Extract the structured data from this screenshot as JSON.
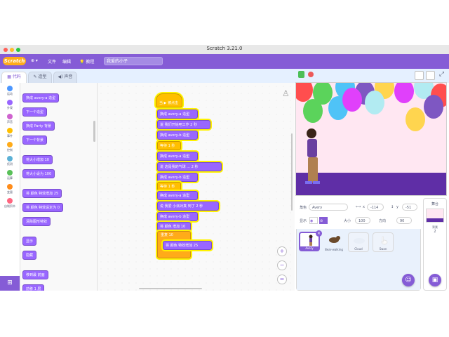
{
  "window": {
    "title": "Scratch 3.21.0"
  },
  "menubar": {
    "logo": "Scratch",
    "items": [
      {
        "label": "⊕ ▾"
      },
      {
        "label": "文件"
      },
      {
        "label": "编辑"
      },
      {
        "label": "教程"
      }
    ],
    "project_title": "我爱的小子"
  },
  "tabs": [
    {
      "label": "代码",
      "active": true
    },
    {
      "label": "造型",
      "active": false
    },
    {
      "label": "声音",
      "active": false
    }
  ],
  "categories": [
    {
      "label": "运动",
      "color": "#4c97ff"
    },
    {
      "label": "外观",
      "color": "#9966ff"
    },
    {
      "label": "声音",
      "color": "#cf63cf"
    },
    {
      "label": "事件",
      "color": "#ffbf00"
    },
    {
      "label": "控制",
      "color": "#ffab19"
    },
    {
      "label": "侦测",
      "color": "#5cb1d6"
    },
    {
      "label": "运算",
      "color": "#59c059"
    },
    {
      "label": "变量",
      "color": "#ff8c1a"
    },
    {
      "label": "自制积木",
      "color": "#ff6680"
    }
  ],
  "palette": {
    "blocks": [
      {
        "text": "换成 avery-a 造型"
      },
      {
        "text": "下一个造型"
      },
      {
        "text": "换成 Party 背景"
      },
      {
        "text": "下一个背景"
      },
      {
        "text": "将大小增加 10"
      },
      {
        "text": "将大小设为 100"
      },
      {
        "text": "将 颜色 特效增加 25"
      },
      {
        "text": "将 颜色 特效设定为 0"
      },
      {
        "text": "清除图形特效"
      },
      {
        "text": "显示"
      },
      {
        "text": "隐藏"
      },
      {
        "text": "移到最 前面"
      },
      {
        "text": "前移 1 层"
      }
    ]
  },
  "script": {
    "blocks": [
      {
        "text": "当 ▶ 被点击",
        "style": "hat"
      },
      {
        "text": "换成 avery-a 造型"
      },
      {
        "text": "说 我们开始吧工作 2 秒"
      },
      {
        "text": "换成 avery-b 造型"
      },
      {
        "text": "等待 1 秒"
      },
      {
        "text": "换成 avery-a 造型"
      },
      {
        "text": "说 这是我的气球 … 2 秒"
      },
      {
        "text": "换成 avery-b 造型"
      },
      {
        "text": "等待 1 秒"
      },
      {
        "text": "换成 avery-a 造型"
      },
      {
        "text": "说 我爱 小派对真 到了 2 秒"
      },
      {
        "text": "换成 avery-b 造型"
      },
      {
        "text": "将 颜色 增加 10"
      },
      {
        "text": "重复 10"
      },
      {
        "text": "将 颜色 特效增加 25"
      }
    ]
  },
  "zoom": {
    "in": "+",
    "out": "−",
    "reset": "="
  },
  "sprite_info": {
    "sprite_label": "角色",
    "sprite_name": "Avery",
    "x_label": "x",
    "x_value": "-114",
    "y_label": "y",
    "y_value": "-51",
    "show_label": "显示",
    "size_label": "大小",
    "size_value": "100",
    "direction_label": "方向",
    "direction_value": "90"
  },
  "sprites": [
    {
      "name": "Avery",
      "selected": true
    },
    {
      "name": "Bear-walking",
      "selected": false
    },
    {
      "name": "Cloud",
      "selected": false
    },
    {
      "name": "Swan",
      "selected": false
    }
  ],
  "stage_panel": {
    "label": "舞台",
    "backdrops_label": "背景",
    "backdrops_count": "2"
  },
  "stage": {
    "balloon_colors": [
      "#ff4e4e",
      "#5bd35b",
      "#4fc3f7",
      "#7e57c2",
      "#ffd54f",
      "#e040fb",
      "#b2ebf2"
    ]
  }
}
